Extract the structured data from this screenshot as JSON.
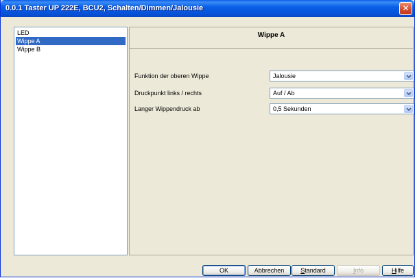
{
  "window": {
    "title": "0.0.1 Taster UP 222E, BCU2, Schalten/Dimmen/Jalousie",
    "close_glyph": "✕"
  },
  "sidebar": {
    "items": [
      {
        "label": "LED",
        "selected": false
      },
      {
        "label": "Wippe A",
        "selected": true
      },
      {
        "label": "Wippe B",
        "selected": false
      }
    ]
  },
  "main": {
    "title": "Wippe A",
    "rows": [
      {
        "label": "Funktion der oberen Wippe",
        "value": "Jalousie"
      },
      {
        "label": "Druckpunkt links / rechts",
        "value": "Auf / Ab"
      },
      {
        "label": "Langer Wippendruck ab",
        "value": "0,5 Sekunden"
      }
    ]
  },
  "buttons": {
    "ok": "OK",
    "cancel": "Abbrechen",
    "standard_first": "S",
    "standard_rest": "tandard",
    "info_first": "I",
    "info_rest": "nfo",
    "help_first": "H",
    "help_rest": "ilfe"
  },
  "icons": {
    "close": "close-icon",
    "dropdown": "chevron-down-icon"
  },
  "colors": {
    "title_bar": "#0a5fe6",
    "selection": "#316ac5",
    "close_button": "#d2492c",
    "dialog_bg": "#ece9d8"
  }
}
